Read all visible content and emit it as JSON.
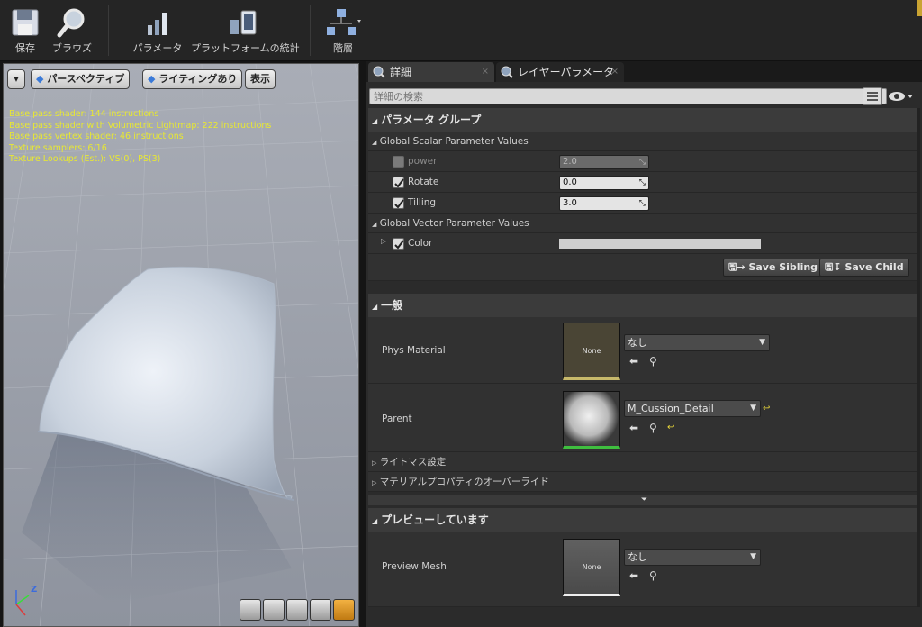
{
  "toolbar": {
    "save": "保存",
    "browse": "ブラウズ",
    "params": "パラメータ",
    "platform_stats": "プラットフォームの統計",
    "hierarchy": "階層"
  },
  "viewport": {
    "perspective": "パースペクティブ",
    "lighting": "ライティングあり",
    "show": "表示",
    "stats": [
      "Base pass shader: 144 instructions",
      "Base pass shader with Volumetric Lightmap: 222 instructions",
      "Base pass vertex shader: 46 instructions",
      "Texture samplers: 6/16",
      "Texture Lookups (Est.): VS(0), PS(3)"
    ],
    "axis_z": "Z"
  },
  "details": {
    "tab_details": "詳細",
    "tab_layer": "レイヤーパラメータ",
    "search_placeholder": "詳細の検索",
    "cat_params": "パラメータ グループ",
    "scalar_group": "Global Scalar Parameter Values",
    "scalar": [
      {
        "name": "power",
        "value": "2.0",
        "checked": false
      },
      {
        "name": "Rotate",
        "value": "0.0",
        "checked": true
      },
      {
        "name": "Tilling",
        "value": "3.0",
        "checked": true
      }
    ],
    "vector_group": "Global Vector Parameter Values",
    "vector_color": "Color",
    "save_sibling": "Save Sibling",
    "save_child": "Save Child",
    "cat_general": "一般",
    "phys_label": "Phys Material",
    "phys_thumb": "None",
    "phys_value": "なし",
    "parent_label": "Parent",
    "parent_value": "M_Cussion_Detail",
    "lightmass": "ライトマス設定",
    "mat_override": "マテリアルプロパティのオーバーライド",
    "cat_preview": "プレビューしています",
    "preview_label": "Preview Mesh",
    "preview_thumb": "None",
    "preview_value": "なし"
  }
}
